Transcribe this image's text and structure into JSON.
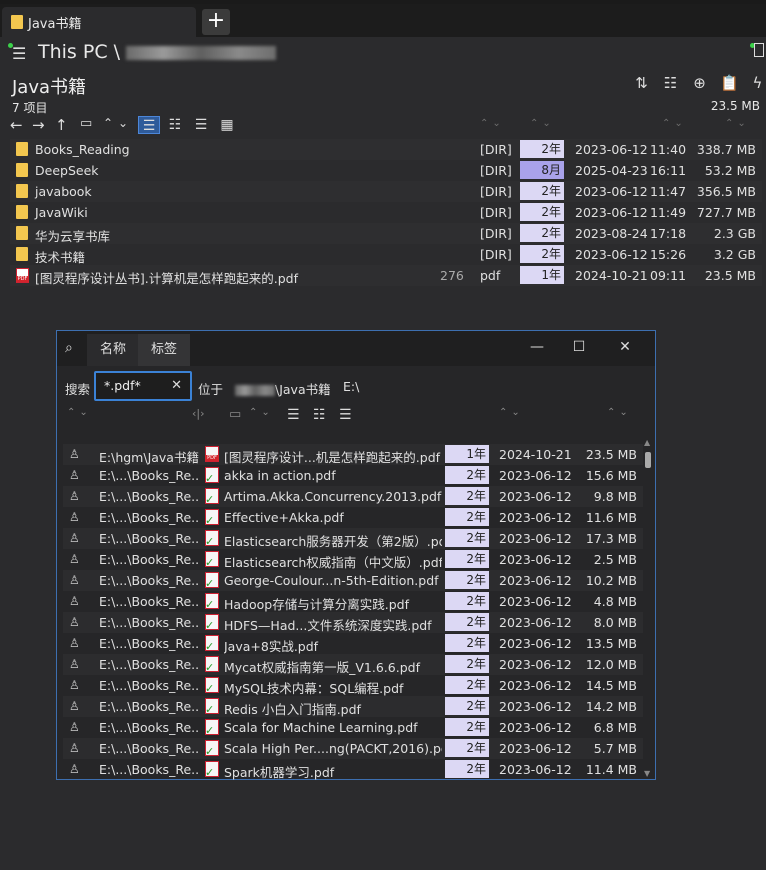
{
  "tab": {
    "title": "Java书籍",
    "new_tab": "+"
  },
  "path": {
    "prefix": "This PC \\"
  },
  "folder": {
    "title": "Java书籍",
    "item_count": "7 项目",
    "total_size": "23.5 MB"
  },
  "files": [
    {
      "name": "Books_Reading",
      "count": "",
      "type": "[DIR]",
      "age": "2年",
      "date": "2023-06-12",
      "time": "11:40",
      "size": "338.7 MB",
      "icon": "folder-icon"
    },
    {
      "name": "DeepSeek",
      "count": "",
      "type": "[DIR]",
      "age": "8月",
      "date": "2025-04-23",
      "time": "16:11",
      "size": "53.2 MB",
      "icon": "folder-icon"
    },
    {
      "name": "javabook",
      "count": "",
      "type": "[DIR]",
      "age": "2年",
      "date": "2023-06-12",
      "time": "11:47",
      "size": "356.5 MB",
      "icon": "folder-icon"
    },
    {
      "name": "JavaWiki",
      "count": "",
      "type": "[DIR]",
      "age": "2年",
      "date": "2023-06-12",
      "time": "11:49",
      "size": "727.7 MB",
      "icon": "folder-icon"
    },
    {
      "name": "华为云享书库",
      "count": "",
      "type": "[DIR]",
      "age": "2年",
      "date": "2023-08-24",
      "time": "17:18",
      "size": "2.3 GB",
      "icon": "folder-icon"
    },
    {
      "name": "技术书籍",
      "count": "",
      "type": "[DIR]",
      "age": "2年",
      "date": "2023-06-12",
      "time": "15:26",
      "size": "3.2 GB",
      "icon": "folder-icon"
    },
    {
      "name": "[图灵程序设计丛书].计算机是怎样跑起来的.pdf",
      "count": "276",
      "type": "pdf",
      "age": "1年",
      "date": "2024-10-21",
      "time": "09:11",
      "size": "23.5 MB",
      "icon": "pdf-icon"
    }
  ],
  "dialog": {
    "tabs": [
      "名称",
      "标签"
    ],
    "search_label": "搜索",
    "query": "*.pdf*",
    "in_label": "位于",
    "in_path": "\\Java书籍",
    "drive": "E:\\",
    "results": [
      {
        "loc": "E:\\hgm\\Java书籍",
        "name": "[图灵程序设计...机是怎样跑起来的.pdf",
        "age": "1年",
        "date": "2024-10-21",
        "size": "23.5 MB",
        "pdf": true
      },
      {
        "loc": "E:\\...\\Books_Re...",
        "name": "akka in action.pdf",
        "age": "2年",
        "date": "2023-06-12",
        "size": "15.6 MB"
      },
      {
        "loc": "E:\\...\\Books_Re...",
        "name": "Artima.Akka.Concurrency.2013.pdf",
        "age": "2年",
        "date": "2023-06-12",
        "size": "9.8 MB"
      },
      {
        "loc": "E:\\...\\Books_Re...",
        "name": "Effective+Akka.pdf",
        "age": "2年",
        "date": "2023-06-12",
        "size": "11.6 MB"
      },
      {
        "loc": "E:\\...\\Books_Re...",
        "name": "Elasticsearch服务器开发（第2版）.pdf",
        "age": "2年",
        "date": "2023-06-12",
        "size": "17.3 MB"
      },
      {
        "loc": "E:\\...\\Books_Re...",
        "name": "Elasticsearch权威指南（中文版）.pdf",
        "age": "2年",
        "date": "2023-06-12",
        "size": "2.5 MB"
      },
      {
        "loc": "E:\\...\\Books_Re...",
        "name": "George-Coulour...n-5th-Edition.pdf",
        "age": "2年",
        "date": "2023-06-12",
        "size": "10.2 MB"
      },
      {
        "loc": "E:\\...\\Books_Re...",
        "name": "Hadoop存储与计算分离实践.pdf",
        "age": "2年",
        "date": "2023-06-12",
        "size": "4.8 MB"
      },
      {
        "loc": "E:\\...\\Books_Re...",
        "name": "HDFS—Had...文件系统深度实践.pdf",
        "age": "2年",
        "date": "2023-06-12",
        "size": "8.0 MB"
      },
      {
        "loc": "E:\\...\\Books_Re...",
        "name": "Java+8实战.pdf",
        "age": "2年",
        "date": "2023-06-12",
        "size": "13.5 MB"
      },
      {
        "loc": "E:\\...\\Books_Re...",
        "name": "Mycat权威指南第一版_V1.6.6.pdf",
        "age": "2年",
        "date": "2023-06-12",
        "size": "12.0 MB"
      },
      {
        "loc": "E:\\...\\Books_Re...",
        "name": "MySQL技术内幕：SQL编程.pdf",
        "age": "2年",
        "date": "2023-06-12",
        "size": "14.5 MB"
      },
      {
        "loc": "E:\\...\\Books_Re...",
        "name": "Redis 小白入门指南.pdf",
        "age": "2年",
        "date": "2023-06-12",
        "size": "14.2 MB"
      },
      {
        "loc": "E:\\...\\Books_Re...",
        "name": "Scala for Machine Learning.pdf",
        "age": "2年",
        "date": "2023-06-12",
        "size": "6.8 MB"
      },
      {
        "loc": "E:\\...\\Books_Re...",
        "name": "Scala High Per....ng(PACKT,2016).pdf",
        "age": "2年",
        "date": "2023-06-12",
        "size": "5.7 MB"
      },
      {
        "loc": "E:\\...\\Books_Re...",
        "name": "Spark机器学习.pdf",
        "age": "2年",
        "date": "2023-06-12",
        "size": "11.4 MB"
      }
    ]
  },
  "colors": {
    "accent": "#3b82d6",
    "age_bg": "#dcd8f4",
    "age_recent": "#a9a2ea",
    "folder": "#f3c74f"
  }
}
